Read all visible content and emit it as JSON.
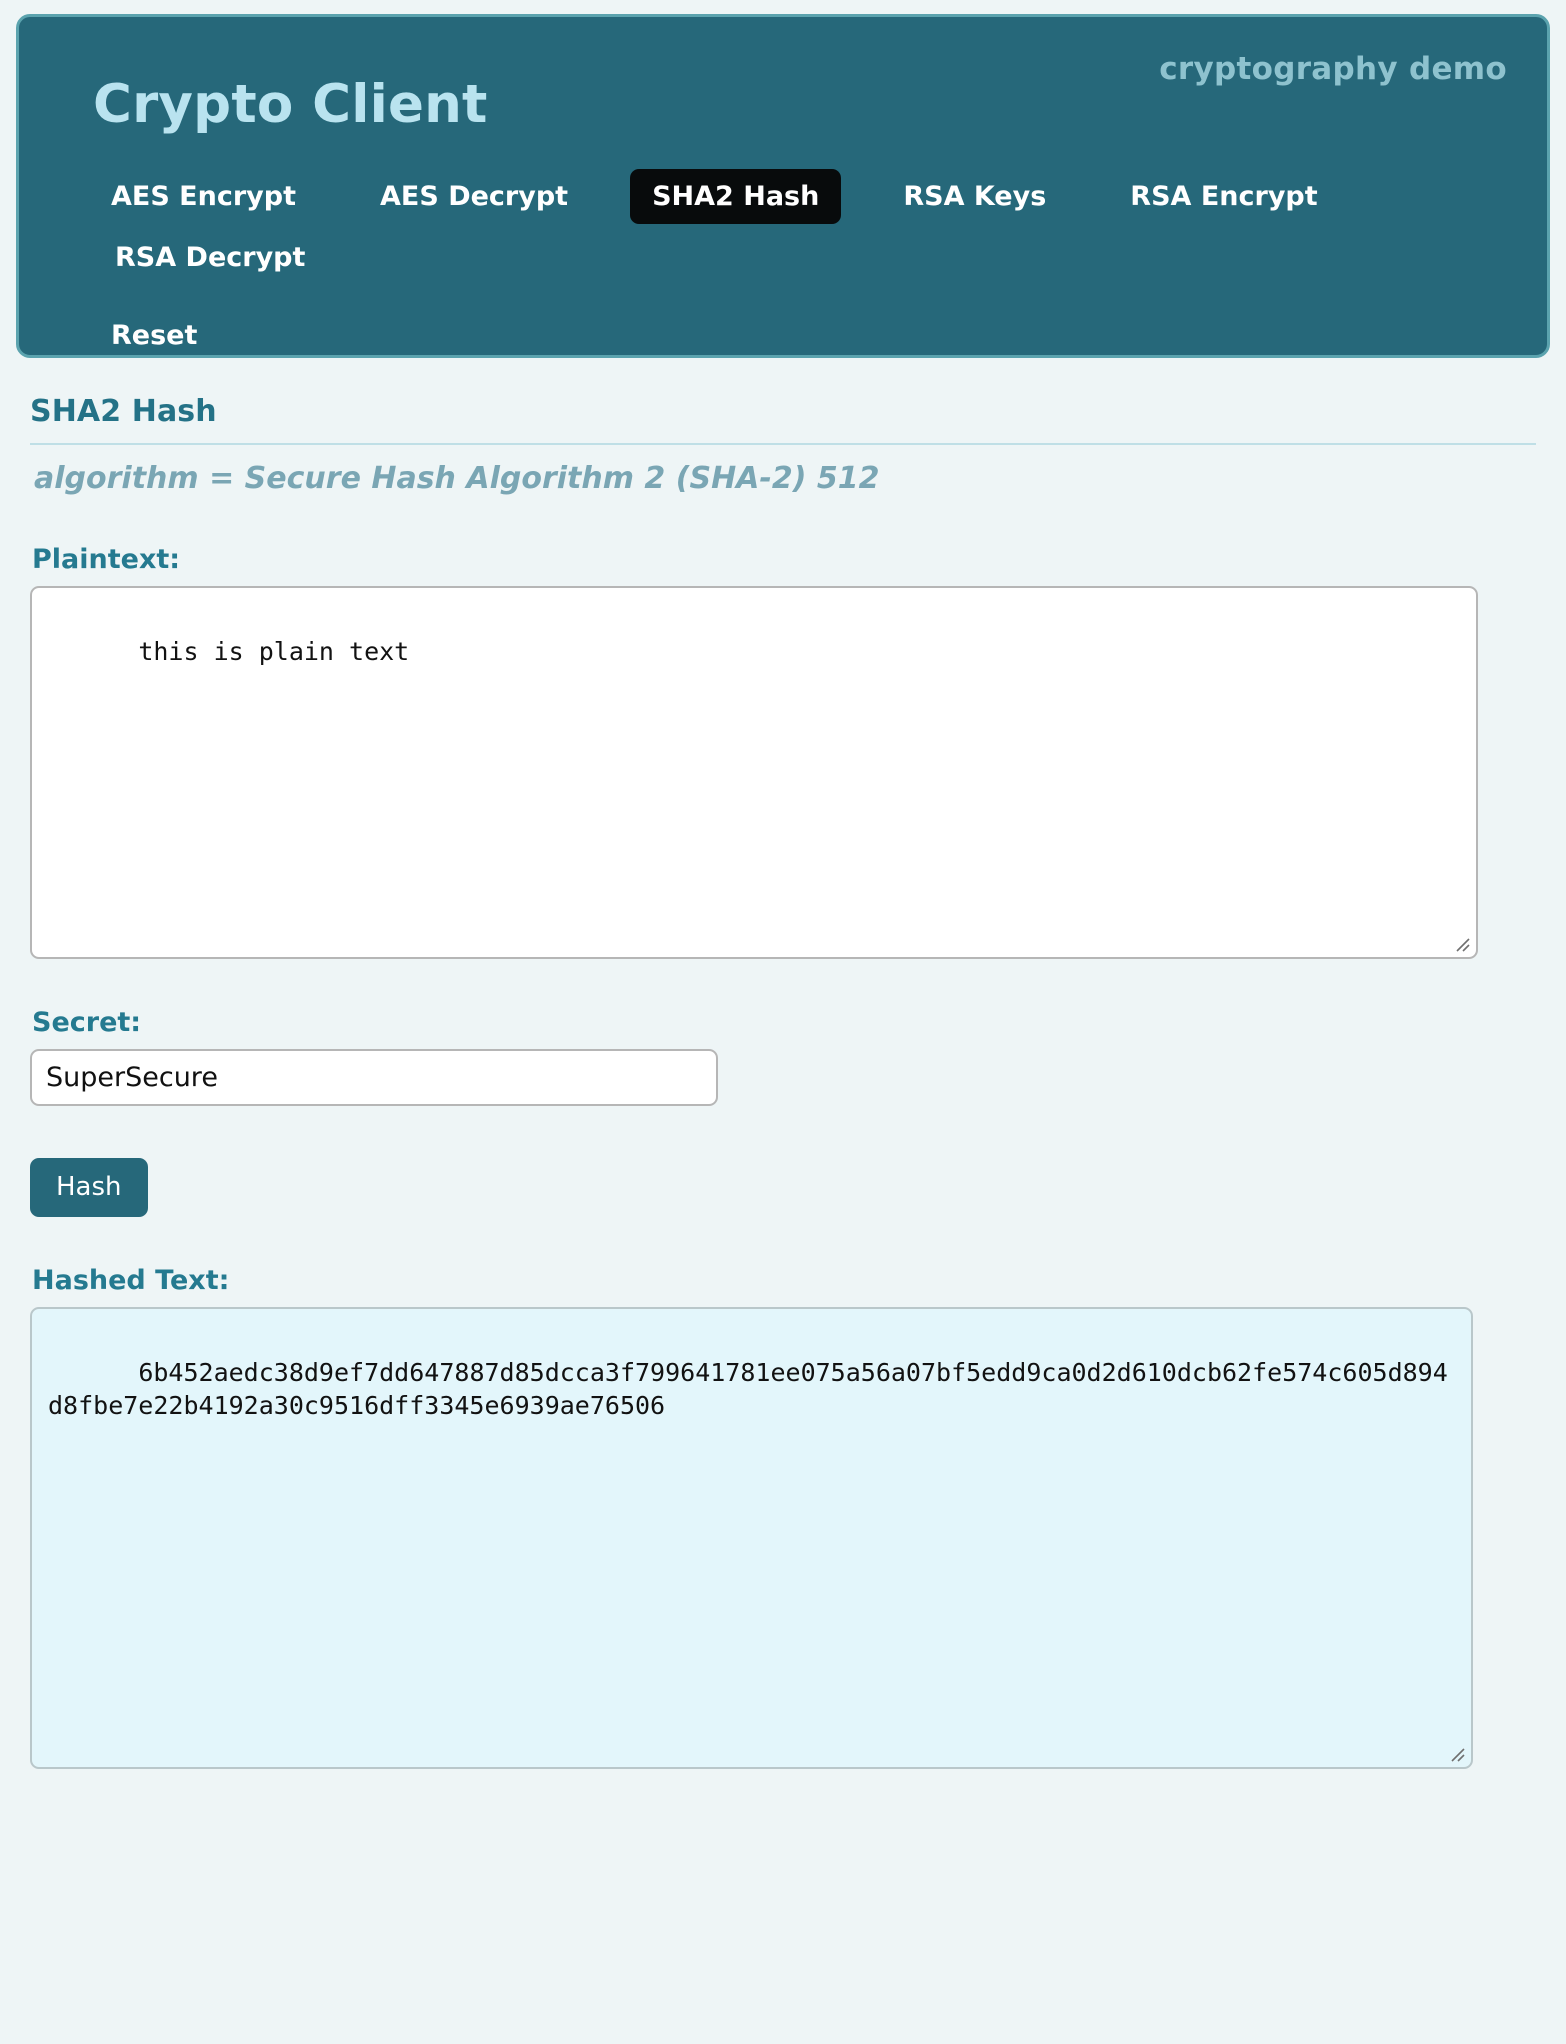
{
  "header": {
    "title": "Crypto Client",
    "tagline": "cryptography demo",
    "nav": [
      {
        "label": "AES Encrypt",
        "active": false
      },
      {
        "label": "AES Decrypt",
        "active": false
      },
      {
        "label": "SHA2 Hash",
        "active": true
      },
      {
        "label": "RSA Keys",
        "active": false
      },
      {
        "label": "RSA Encrypt",
        "active": false
      },
      {
        "label": "RSA Decrypt",
        "active": false
      }
    ],
    "reset_label": "Reset"
  },
  "section": {
    "title": "SHA2 Hash",
    "algorithm_line": "algorithm = Secure Hash Algorithm 2 (SHA-2) 512"
  },
  "plaintext": {
    "label": "Plaintext:",
    "value": "this is plain text"
  },
  "secret": {
    "label": "Secret:",
    "value": "SuperSecure"
  },
  "hash_button": {
    "label": "Hash"
  },
  "hashed": {
    "label": "Hashed Text:",
    "value": "6b452aedc38d9ef7dd647887d85dcca3f799641781ee075a56a07bf5edd9ca0d2d610dcb62fe574c605d894d8fbe7e22b4192a30c9516dff3345e6939ae76506"
  },
  "colors": {
    "page_bg": "#eef5f6",
    "header_bg": "#26687a",
    "header_border": "#5ba3ae",
    "brand_title": "#b9e3ef",
    "tagline": "#8ec2ce",
    "active_tab_bg": "#080b0c",
    "label": "#257a90",
    "algo_text": "#7aa6b4",
    "output_bg": "#e3f6fb"
  }
}
